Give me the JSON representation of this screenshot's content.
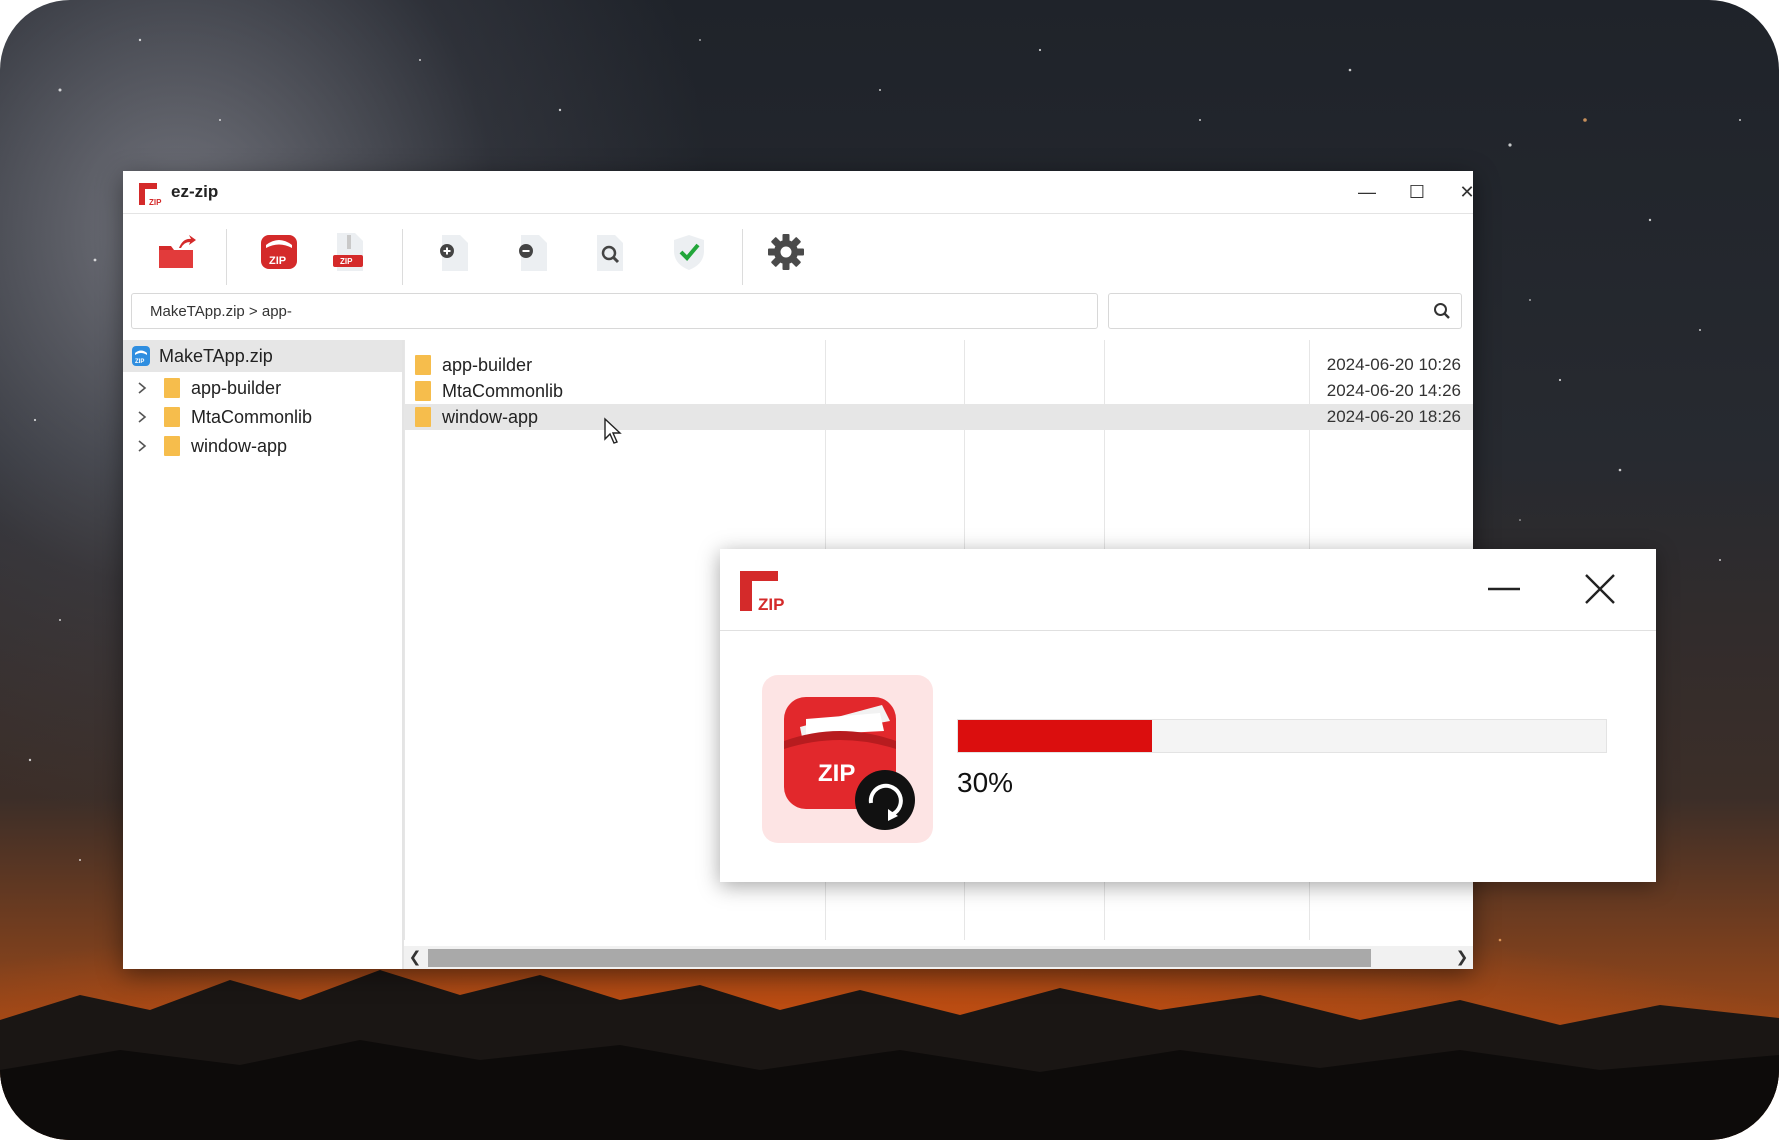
{
  "window": {
    "title": "ez-zip",
    "controls": {
      "minimize": "—",
      "maximize": "☐",
      "close": "✕"
    }
  },
  "toolbar": {
    "buttons": [
      {
        "name": "open-archive",
        "icon": "folder-export-icon"
      },
      {
        "name": "create-zip",
        "icon": "zip-bag-icon"
      },
      {
        "name": "zip-file",
        "icon": "zip-file-icon"
      },
      {
        "name": "add-file",
        "icon": "add-file-icon"
      },
      {
        "name": "remove-file",
        "icon": "remove-file-icon"
      },
      {
        "name": "view-file",
        "icon": "magnify-file-icon"
      },
      {
        "name": "verify",
        "icon": "shield-check-icon"
      },
      {
        "name": "settings",
        "icon": "gear-icon"
      }
    ]
  },
  "path": {
    "text": "MakeTApp.zip > app-"
  },
  "search": {
    "value": "",
    "placeholder": ""
  },
  "tree": {
    "root": "MakeTApp.zip",
    "items": [
      {
        "label": "app-builder"
      },
      {
        "label": "MtaCommonlib"
      },
      {
        "label": "window-app"
      }
    ]
  },
  "files": [
    {
      "name": "app-builder",
      "date": "2024-06-20  10:26",
      "selected": false
    },
    {
      "name": "MtaCommonlib",
      "date": "2024-06-20  14:26",
      "selected": false
    },
    {
      "name": "window-app",
      "date": "2024-06-20  18:26",
      "selected": true
    }
  ],
  "scrollbar": {
    "left_arrow": "❮",
    "right_arrow": "❯"
  },
  "dialog": {
    "logo_text": "ZIP",
    "progress_percent": 30,
    "progress_label": "30%",
    "app_icon_text": "ZIP"
  },
  "colors": {
    "accent": "#db0e0e",
    "folder": "#f6bd4c",
    "selection": "#e6e6e6"
  }
}
